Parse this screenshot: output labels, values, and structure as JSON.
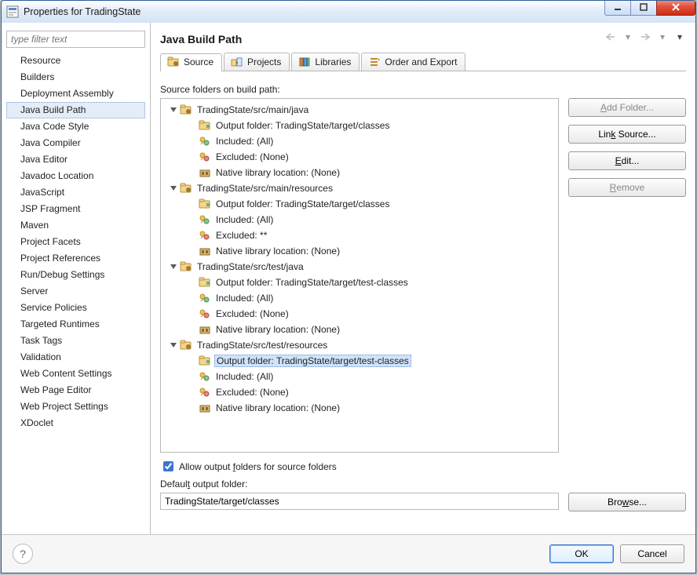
{
  "window": {
    "title": "Properties for TradingState"
  },
  "filter": {
    "placeholder": "type filter text"
  },
  "categories": [
    "Resource",
    "Builders",
    "Deployment Assembly",
    "Java Build Path",
    "Java Code Style",
    "Java Compiler",
    "Java Editor",
    "Javadoc Location",
    "JavaScript",
    "JSP Fragment",
    "Maven",
    "Project Facets",
    "Project References",
    "Run/Debug Settings",
    "Server",
    "Service Policies",
    "Targeted Runtimes",
    "Task Tags",
    "Validation",
    "Web Content Settings",
    "Web Page Editor",
    "Web Project Settings",
    "XDoclet"
  ],
  "categories_selected_index": 3,
  "page": {
    "title": "Java Build Path",
    "tabs": [
      "Source",
      "Projects",
      "Libraries",
      "Order and Export"
    ],
    "active_tab_index": 0
  },
  "source_tab": {
    "heading": "Source folders on build path:",
    "folders": [
      {
        "path": "TradingState/src/main/java",
        "output": "Output folder: TradingState/target/classes",
        "included": "Included: (All)",
        "excluded": "Excluded: (None)",
        "native": "Native library location: (None)"
      },
      {
        "path": "TradingState/src/main/resources",
        "output": "Output folder: TradingState/target/classes",
        "included": "Included: (All)",
        "excluded": "Excluded: **",
        "native": "Native library location: (None)"
      },
      {
        "path": "TradingState/src/test/java",
        "output": "Output folder: TradingState/target/test-classes",
        "included": "Included: (All)",
        "excluded": "Excluded: (None)",
        "native": "Native library location: (None)"
      },
      {
        "path": "TradingState/src/test/resources",
        "output": "Output folder: TradingState/target/test-classes",
        "included": "Included: (All)",
        "excluded": "Excluded: (None)",
        "native": "Native library location: (None)"
      }
    ],
    "selected": {
      "folder_index": 3,
      "child_key": "output"
    },
    "allow_checkbox": {
      "checked": true,
      "label_pre": "Allow output ",
      "underline": "f",
      "label_post": "olders for source folders"
    },
    "default_label_pre": "Defaul",
    "default_underline": "t",
    "default_label_post": " output folder:",
    "default_value": "TradingState/target/classes"
  },
  "buttons": {
    "add_folder": "Add Folder...",
    "link_source": "Link Source...",
    "edit": "Edit...",
    "remove": "Remove",
    "browse": "Browse...",
    "ok": "OK",
    "cancel": "Cancel"
  },
  "icons": {
    "app": "properties-icon",
    "tab_source": "package-folder-icon",
    "tab_projects": "projects-icon",
    "tab_libraries": "library-icon",
    "tab_order": "order-export-icon",
    "folder": "package-folder-icon",
    "output": "output-folder-icon",
    "included": "include-filter-icon",
    "excluded": "exclude-filter-icon",
    "native": "native-lib-icon"
  }
}
